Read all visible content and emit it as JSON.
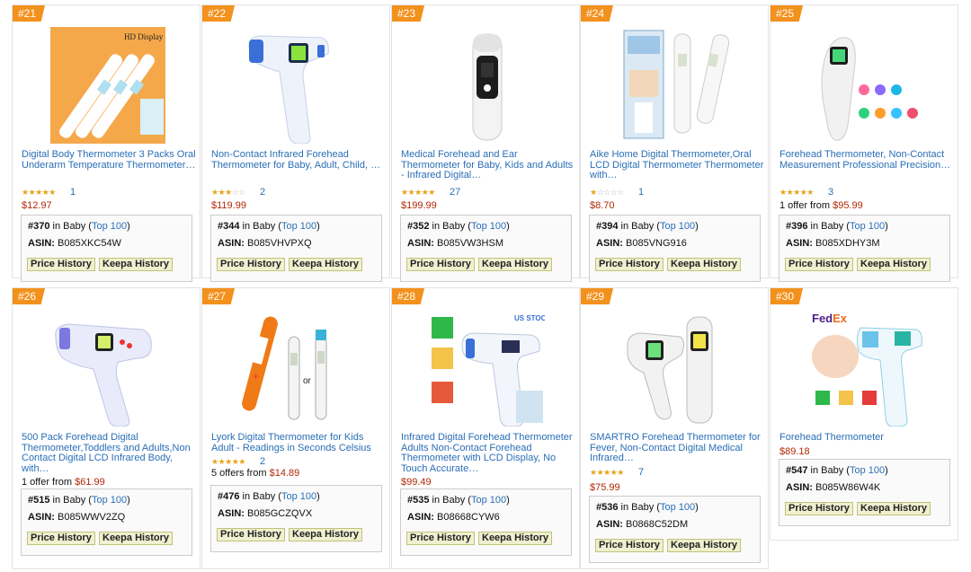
{
  "products": [
    {
      "rank": "#21",
      "title": "Digital Body Thermometer 3 Packs Oral Underarm Temperature Thermometer…",
      "stars": 5,
      "reviews": "1",
      "price": "$12.97",
      "offer_prefix": "",
      "offer_price": "",
      "bsr": "#370",
      "category": "in Baby (",
      "top": "Top 100",
      "close": ")",
      "asin_label": "ASIN:",
      "asin": "B085XKC54W",
      "img_label": "HD Display",
      "img_type": "multi-stick",
      "price_history": "Price History",
      "keepa_history": "Keepa History"
    },
    {
      "rank": "#22",
      "title": "Non-Contact Infrared Forehead Thermometer for Baby, Adult, Child, …",
      "stars": 3,
      "reviews": "2",
      "price": "$119.99",
      "offer_prefix": "",
      "offer_price": "",
      "bsr": "#344",
      "category": "in Baby (",
      "top": "Top 100",
      "close": ")",
      "asin_label": "ASIN:",
      "asin": "B085VHVPXQ",
      "img_label": "",
      "img_type": "gun-blue",
      "price_history": "Price History",
      "keepa_history": "Keepa History"
    },
    {
      "rank": "#23",
      "title": "Medical Forehead and Ear Thermometer for Baby, Kids and Adults - Infrared Digital…",
      "stars": 5,
      "reviews": "27",
      "price": "$199.99",
      "offer_prefix": "",
      "offer_price": "",
      "bsr": "#352",
      "category": "in Baby (",
      "top": "Top 100",
      "close": ")",
      "asin_label": "ASIN:",
      "asin": "B085VW3HSM",
      "img_label": "",
      "img_type": "ear-dark",
      "price_history": "Price History",
      "keepa_history": "Keepa History"
    },
    {
      "rank": "#24",
      "title": "Aike Home Digital Thermometer,Oral LCD Digital Thermometer Thermometer with…",
      "stars": 1,
      "reviews": "1",
      "price": "$8.70",
      "offer_prefix": "",
      "offer_price": "",
      "bsr": "#394",
      "category": "in Baby (",
      "top": "Top 100",
      "close": ")",
      "asin_label": "ASIN:",
      "asin": "B085VNG916",
      "img_label": "",
      "img_type": "box-stick",
      "price_history": "Price History",
      "keepa_history": "Keepa History"
    },
    {
      "rank": "#25",
      "title": "Forehead Thermometer, Non-Contact Measurement Professional Precision…",
      "stars": 5,
      "reviews": "3",
      "price": "",
      "offer_prefix": "1 offer from ",
      "offer_price": "$95.99",
      "bsr": "#396",
      "category": "in Baby (",
      "top": "Top 100",
      "close": ")",
      "asin_label": "ASIN:",
      "asin": "B085XDHY3M",
      "img_label": "",
      "img_type": "white-icons",
      "price_history": "Price History",
      "keepa_history": "Keepa History"
    },
    {
      "rank": "#26",
      "title": "500 Pack Forehead Digital Thermometer,Toddlers and Adults,Non Contact Digital LCD Infrared Body, with…",
      "stars": 0,
      "reviews": "",
      "price": "",
      "offer_prefix": "1 offer from ",
      "offer_price": "$61.99",
      "bsr": "#515",
      "category": "in Baby (",
      "top": "Top 100",
      "close": ")",
      "asin_label": "ASIN:",
      "asin": "B085WWV2ZQ",
      "img_label": "",
      "img_type": "gun-purple",
      "price_history": "Price History",
      "keepa_history": "Keepa History"
    },
    {
      "rank": "#27",
      "title": "Lyork Digital Thermometer for Kids Adult - Readings in Seconds Celsius",
      "stars": 5,
      "reviews": "2",
      "price": "",
      "offer_prefix": "5 offers from ",
      "offer_price": "$14.89",
      "bsr": "#476",
      "category": "in Baby (",
      "top": "Top 100",
      "close": ")",
      "asin_label": "ASIN:",
      "asin": "B085GCZQVX",
      "img_label": "or",
      "img_type": "orange-stick",
      "price_history": "Price History",
      "keepa_history": "Keepa History"
    },
    {
      "rank": "#28",
      "title": "Infrared Digital Forehead Thermometer Adults Non-Contact Forehead Thermometer with LCD Display, No Touch Accurate…",
      "stars": 0,
      "reviews": "",
      "price": "$99.49",
      "offer_prefix": "",
      "offer_price": "",
      "bsr": "#535",
      "category": "in Baby (",
      "top": "Top 100",
      "close": ")",
      "asin_label": "ASIN:",
      "asin": "B08668CYW6",
      "img_label": "US STOCK",
      "img_type": "gun-screens",
      "price_history": "Price History",
      "keepa_history": "Keepa History"
    },
    {
      "rank": "#29",
      "title": "SMARTRO Forehead Thermometer for Fever, Non-Contact Digital Medical Infrared…",
      "stars": 5,
      "reviews": "7",
      "price": "$75.99",
      "offer_prefix": "",
      "offer_price": "",
      "bsr": "#536",
      "category": "in Baby (",
      "top": "Top 100",
      "close": ")",
      "asin_label": "ASIN:",
      "asin": "B0868C52DM",
      "img_label": "",
      "img_type": "white-pair",
      "price_history": "Price History",
      "keepa_history": "Keepa History"
    },
    {
      "rank": "#30",
      "title": "Forehead Thermometer",
      "stars": 0,
      "reviews": "",
      "price": "$89.18",
      "offer_prefix": "",
      "offer_price": "",
      "bsr": "#547",
      "category": "in Baby (",
      "top": "Top 100",
      "close": ")",
      "asin_label": "ASIN:",
      "asin": "B085W86W4K",
      "img_label": "FedEx",
      "img_type": "fedex-baby",
      "price_history": "Price History",
      "keepa_history": "Keepa History"
    }
  ],
  "colors": {
    "rank_badge": "#f3911d",
    "link": "#2a6eb5",
    "price": "#b12704",
    "star": "#e8a317"
  }
}
